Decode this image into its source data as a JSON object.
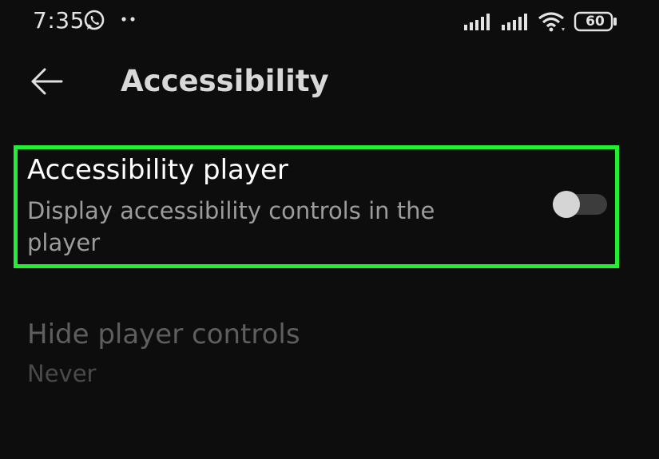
{
  "status_bar": {
    "time": "7:35",
    "battery": "60",
    "icons": [
      "whatsapp-icon",
      "more-dots-icon",
      "signal-icon",
      "signal-icon",
      "wifi-icon",
      "battery-icon"
    ]
  },
  "header": {
    "title": "Accessibility",
    "back_icon": "arrow-left-icon"
  },
  "settings": [
    {
      "title": "Accessibility player",
      "description": "Display accessibility controls in the player",
      "toggle_state": "off",
      "highlighted": true
    },
    {
      "title": "Hide player controls",
      "value": "Never",
      "enabled": false
    }
  ],
  "colors": {
    "background": "#0d0d0d",
    "highlight_border": "#22ee33",
    "toggle_knob": "#d5d5d5",
    "toggle_track": "#3c3c3c"
  }
}
